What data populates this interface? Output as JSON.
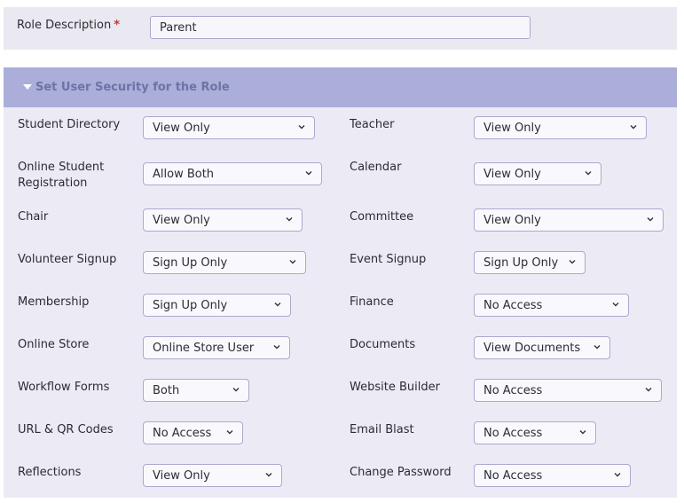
{
  "role": {
    "label": "Role Description",
    "required_marker": "*",
    "value": "Parent"
  },
  "section": {
    "title": "Set User Security for the Role",
    "expanded": true
  },
  "permissions": [
    {
      "label": "Student Directory",
      "value": "View Only"
    },
    {
      "label": "Teacher",
      "value": "View Only"
    },
    {
      "label": "Online Student Registration",
      "value": "Allow Both"
    },
    {
      "label": "Calendar",
      "value": "View Only"
    },
    {
      "label": "Chair",
      "value": "View Only"
    },
    {
      "label": "Committee",
      "value": "View Only"
    },
    {
      "label": "Volunteer Signup",
      "value": "Sign Up Only"
    },
    {
      "label": "Event Signup",
      "value": "Sign Up Only"
    },
    {
      "label": "Membership",
      "value": "Sign Up Only"
    },
    {
      "label": "Finance",
      "value": "No Access"
    },
    {
      "label": "Online Store",
      "value": "Online Store User"
    },
    {
      "label": "Documents",
      "value": "View Documents"
    },
    {
      "label": "Workflow Forms",
      "value": "Both"
    },
    {
      "label": "Website Builder",
      "value": "No Access"
    },
    {
      "label": "URL & QR Codes",
      "value": "No Access"
    },
    {
      "label": "Email Blast",
      "value": "No Access"
    },
    {
      "label": "Reflections",
      "value": "View Only"
    },
    {
      "label": "Change Password",
      "value": "No Access"
    }
  ],
  "colors": {
    "header_bg": "#AAAED8",
    "header_text": "#6E72A6",
    "panel_bg": "#ECEBF5",
    "required": "#c0392b"
  }
}
